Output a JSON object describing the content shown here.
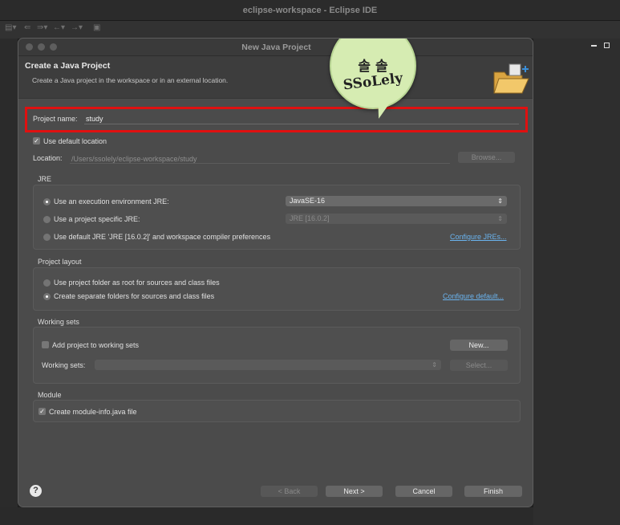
{
  "window": {
    "title": "eclipse-workspace - Eclipse IDE"
  },
  "toolbar": {
    "icons": [
      "new-wizard-icon",
      "prev-edit-icon",
      "next-edit-icon",
      "back-icon",
      "forward-icon",
      "pin-editor-icon"
    ]
  },
  "dialog": {
    "title": "New Java Project",
    "header": {
      "title": "Create a Java Project",
      "subtitle": "Create a Java project in the workspace or in an external location."
    },
    "project_name": {
      "label": "Project name:",
      "value": "study"
    },
    "use_default_location": {
      "label": "Use default location",
      "checked": true
    },
    "location": {
      "label": "Location:",
      "value": "/Users/ssolely/eclipse-workspace/study",
      "browse_label": "Browse..."
    },
    "jre": {
      "title": "JRE",
      "options": [
        {
          "label": "Use an execution environment JRE:",
          "selected": true
        },
        {
          "label": "Use a project specific JRE:",
          "selected": false
        },
        {
          "label": "Use default JRE 'JRE [16.0.2]' and workspace compiler preferences",
          "selected": false
        }
      ],
      "env_combo": "JavaSE-16",
      "specific_combo": "JRE [16.0.2]",
      "configure_link": "Configure JREs..."
    },
    "layout": {
      "title": "Project layout",
      "options": [
        {
          "label": "Use project folder as root for sources and class files",
          "selected": false
        },
        {
          "label": "Create separate folders for sources and class files",
          "selected": true
        }
      ],
      "configure_link": "Configure default..."
    },
    "working_sets": {
      "title": "Working sets",
      "add_label": "Add project to working sets",
      "add_checked": false,
      "new_label": "New...",
      "sets_label": "Working sets:",
      "select_label": "Select..."
    },
    "module": {
      "title": "Module",
      "create_label": "Create module-info.java file",
      "checked": true
    },
    "buttons": {
      "help": "?",
      "back": "< Back",
      "next": "Next >",
      "cancel": "Cancel",
      "finish": "Finish"
    }
  },
  "watermark": {
    "line1": "솔 솔",
    "line2": "SSoLely"
  },
  "colors": {
    "highlight": "#e01010",
    "link": "#6ab3ee",
    "watermark_bg": "#d6ecb2"
  }
}
